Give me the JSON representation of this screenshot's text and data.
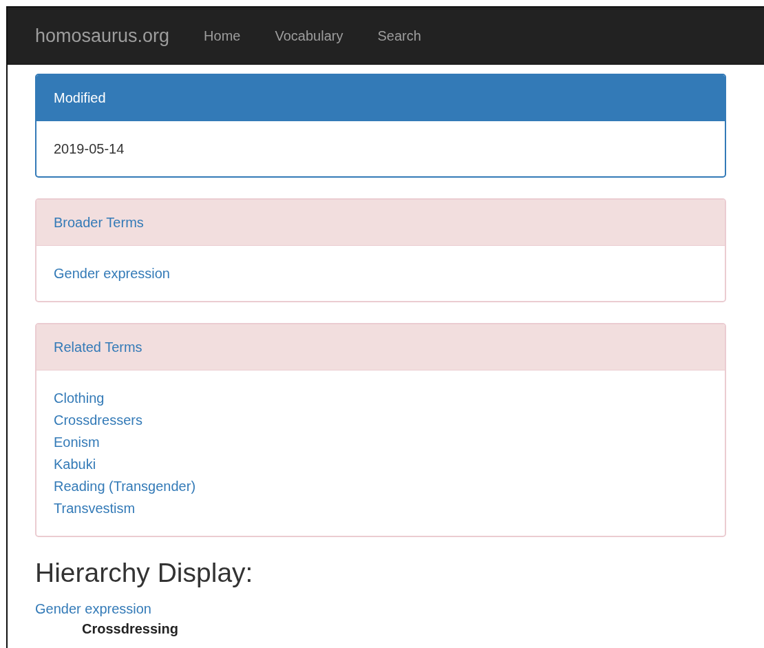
{
  "navbar": {
    "brand": "homosaurus.org",
    "links": [
      {
        "label": "Home"
      },
      {
        "label": "Vocabulary"
      },
      {
        "label": "Search"
      }
    ]
  },
  "panels": [
    {
      "kind": "primary",
      "title": "Modified",
      "items": [
        {
          "kind": "text",
          "label": "2019-05-14"
        }
      ]
    },
    {
      "kind": "danger",
      "title": "Broader Terms",
      "items": [
        {
          "kind": "link",
          "label": "Gender expression"
        }
      ]
    },
    {
      "kind": "danger",
      "title": "Related Terms",
      "items": [
        {
          "kind": "link",
          "label": "Clothing"
        },
        {
          "kind": "link",
          "label": "Crossdressers"
        },
        {
          "kind": "link",
          "label": "Eonism"
        },
        {
          "kind": "link",
          "label": "Kabuki"
        },
        {
          "kind": "link",
          "label": "Reading (Transgender)"
        },
        {
          "kind": "link",
          "label": "Transvestism"
        }
      ]
    }
  ],
  "hierarchy": {
    "title": "Hierarchy Display:",
    "tree": [
      {
        "kind": "link",
        "label": "Gender expression",
        "children": [
          {
            "kind": "current",
            "label": "Crossdressing"
          }
        ]
      }
    ]
  }
}
